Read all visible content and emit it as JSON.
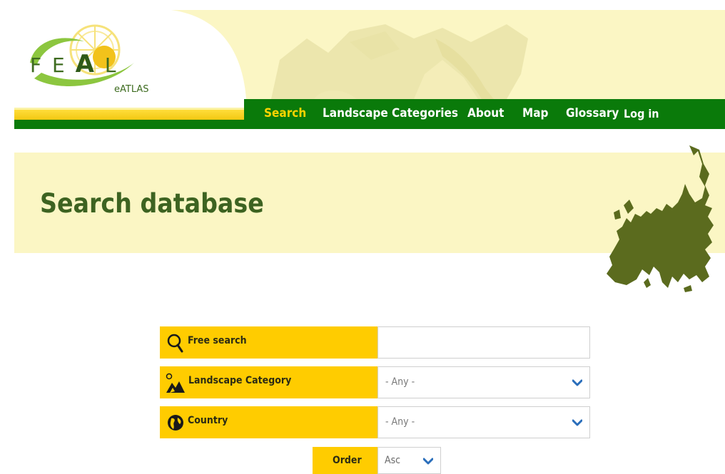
{
  "site": {
    "logo_letters": [
      "F",
      "E",
      "A",
      "L"
    ],
    "logo_subtitle": "eATLAS"
  },
  "nav": {
    "items": [
      {
        "label": "Search",
        "active": true
      },
      {
        "label": "Landscape Categories",
        "active": false
      },
      {
        "label": "About",
        "active": false
      },
      {
        "label": "Map",
        "active": false
      },
      {
        "label": "Glossary",
        "active": false
      }
    ],
    "login": "Log in"
  },
  "page": {
    "title": "Search database"
  },
  "form": {
    "free_search": {
      "label": "Free search",
      "value": "",
      "icon": "search-icon"
    },
    "landscape_category": {
      "label": "Landscape Category",
      "value": "- Any -",
      "icon": "landscape-icon"
    },
    "country": {
      "label": "Country",
      "value": "- Any -",
      "icon": "globe-icon"
    },
    "order": {
      "label": "Order",
      "value": "Asc"
    }
  },
  "colors": {
    "nav_green": "#0a7a0a",
    "active_nav": "#ffd400",
    "label_yellow": "#ffcc00",
    "banner_bg": "#fbf6c4",
    "title_green": "#3d6321",
    "map_green": "#5b6b1e",
    "chevron_blue": "#2a6ebb"
  }
}
